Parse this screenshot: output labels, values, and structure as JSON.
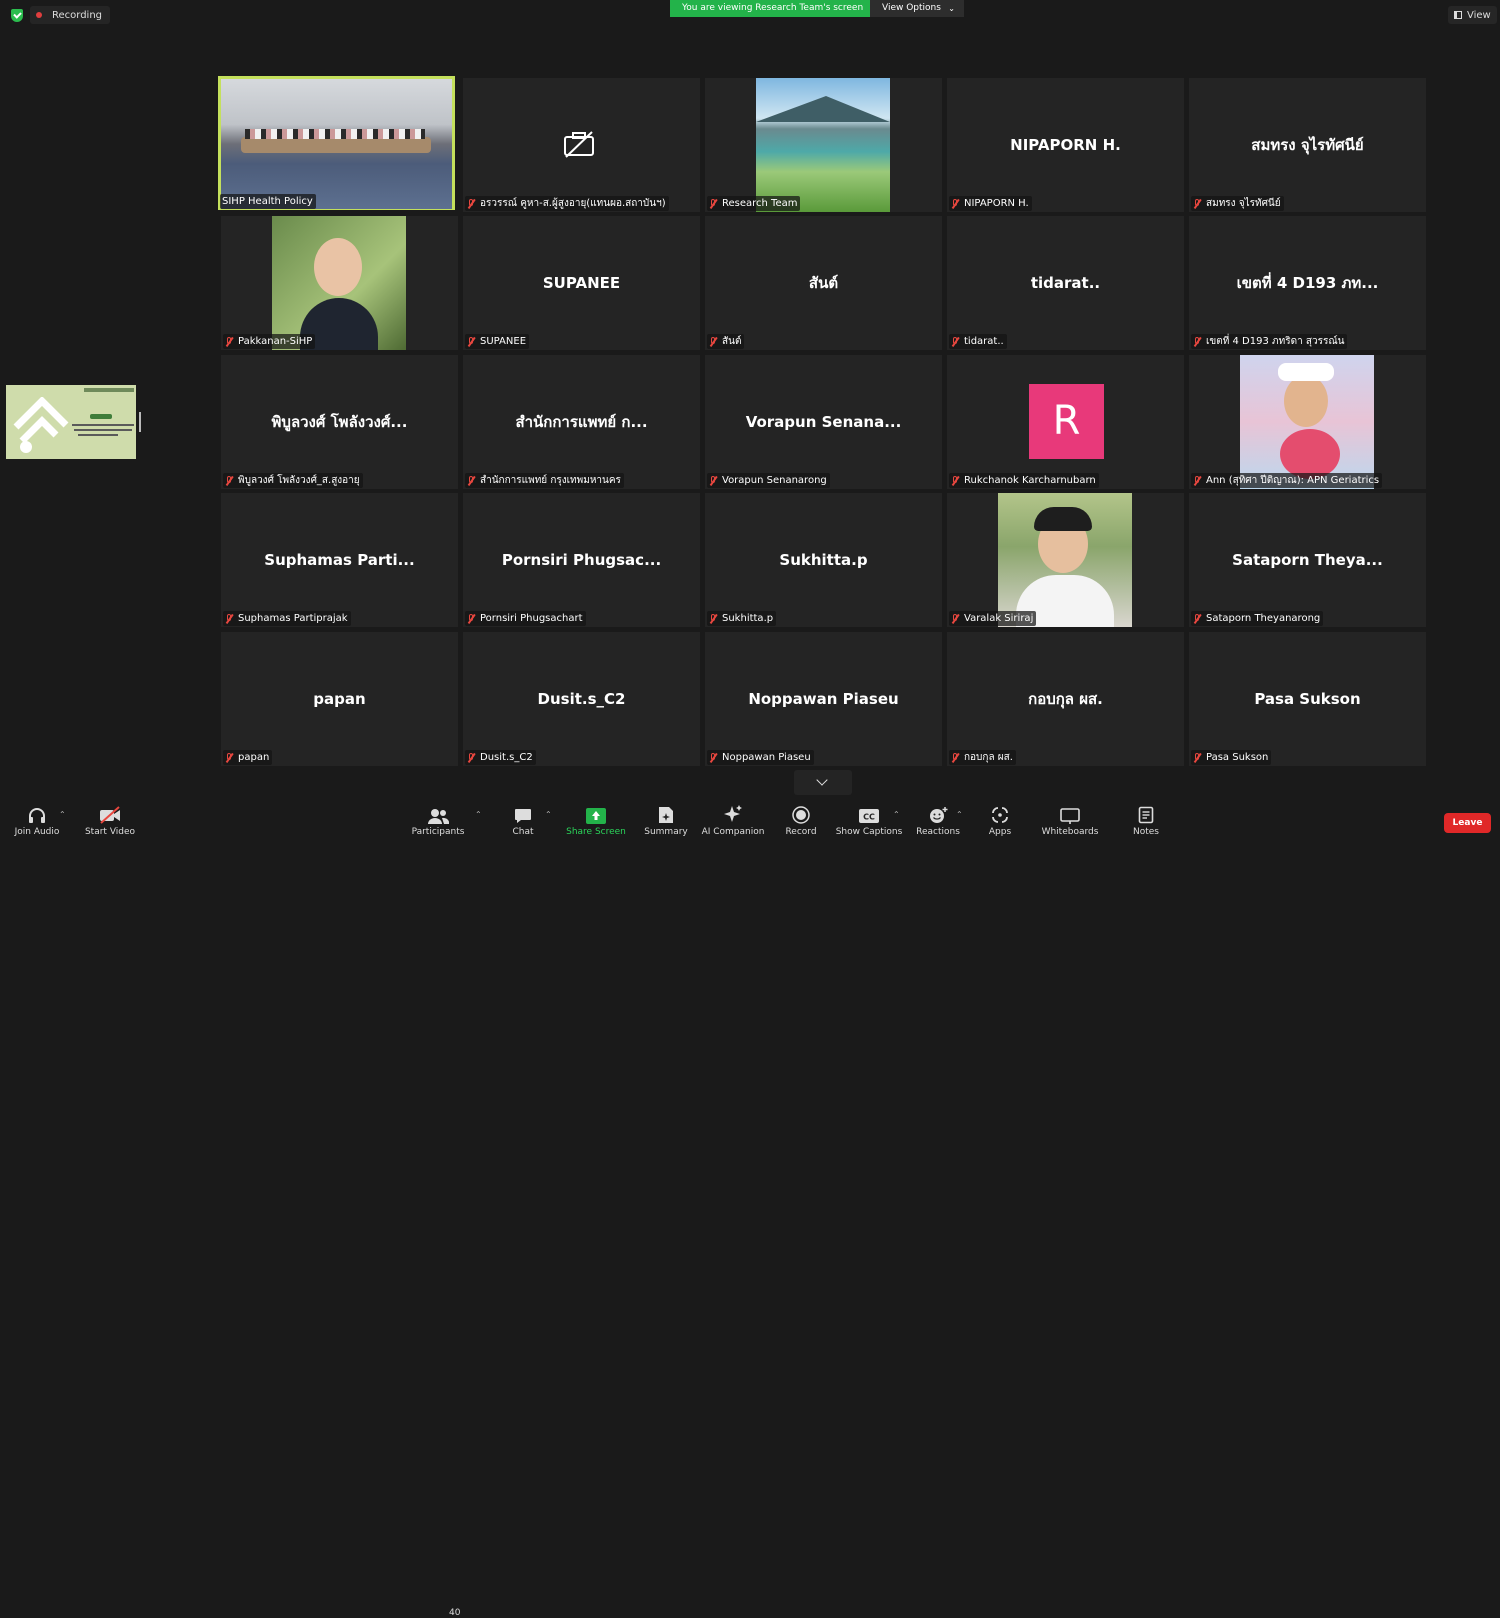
{
  "topbar": {
    "recording": "Recording",
    "viewing_banner": "You are viewing Research Team's screen",
    "view_options": "View Options",
    "view": "View"
  },
  "tiles": [
    {
      "label": "SIHP Health Policy",
      "type": "video"
    },
    {
      "label": "อรวรรณ์ คูหา-ส.ผู้สูงอายุ(แทนผอ.สถาบันฯ)",
      "type": "video-off"
    },
    {
      "label": "Research Team",
      "type": "video"
    },
    {
      "label": "NIPAPORN H.",
      "name": "NIPAPORN H.",
      "type": "name"
    },
    {
      "label": "สมทรง จุไรทัศนีย์",
      "name": "สมทรง จุไรทัศนีย์",
      "type": "name"
    },
    {
      "label": "Pakkanan-SiHP",
      "type": "video"
    },
    {
      "label": "SUPANEE",
      "name": "SUPANEE",
      "type": "name"
    },
    {
      "label": "สันต์",
      "name": "สันต์",
      "type": "name"
    },
    {
      "label": "tidarat..",
      "name": "tidarat..",
      "type": "name"
    },
    {
      "label": "เขตที่ 4 D193 ภทริดา สุวรรณ์น",
      "name": "เขตที่ 4 D193 ภท...",
      "type": "name"
    },
    {
      "label": "พิบูลวงศ์ โพลังวงศ์_ส.สูงอายุ",
      "name": "พิบูลวงศ์ โพลังวงศ์...",
      "type": "name"
    },
    {
      "label": "สำนักการแพทย์ กรุงเทพมหานคร",
      "name": "สำนักการแพทย์ ก...",
      "type": "name"
    },
    {
      "label": "Vorapun Senanarong",
      "name": "Vorapun Senana...",
      "type": "name"
    },
    {
      "label": "Rukchanok Karcharnubarn",
      "avatar": "R",
      "type": "avatar"
    },
    {
      "label": "Ann (สุทิศา ปีติญาณ): APN Geriatrics",
      "type": "video"
    },
    {
      "label": "Suphamas Partiprajak",
      "name": "Suphamas Parti...",
      "type": "name"
    },
    {
      "label": "Pornsiri Phugsachart",
      "name": "Pornsiri Phugsac...",
      "type": "name"
    },
    {
      "label": "Sukhitta.p",
      "name": "Sukhitta.p",
      "type": "name"
    },
    {
      "label": "Varalak Siriraj",
      "type": "video"
    },
    {
      "label": "Sataporn Theyanarong",
      "name": "Sataporn Theya...",
      "type": "name"
    },
    {
      "label": "papan",
      "name": "papan",
      "type": "name"
    },
    {
      "label": "Dusit.s_C2",
      "name": "Dusit.s_C2",
      "type": "name"
    },
    {
      "label": "Noppawan Piaseu",
      "name": "Noppawan Piaseu",
      "type": "name"
    },
    {
      "label": "กอบกุล ผส.",
      "name": "กอบกุล ผส.",
      "type": "name"
    },
    {
      "label": "Pasa Sukson",
      "name": "Pasa Sukson",
      "type": "name"
    }
  ],
  "toolbar": {
    "join_audio": "Join Audio",
    "start_video": "Start Video",
    "participants": "Participants",
    "participants_count": "40",
    "chat": "Chat",
    "share_screen": "Share Screen",
    "summary": "Summary",
    "ai_companion": "AI Companion",
    "record": "Record",
    "show_captions": "Show Captions",
    "reactions": "Reactions",
    "apps": "Apps",
    "whiteboards": "Whiteboards",
    "notes": "Notes",
    "leave": "Leave"
  },
  "colors": {
    "accent_green": "#23b34a",
    "active_speaker": "#c4e05c",
    "leave_red": "#e02828",
    "avatar_pink": "#e8397a"
  }
}
